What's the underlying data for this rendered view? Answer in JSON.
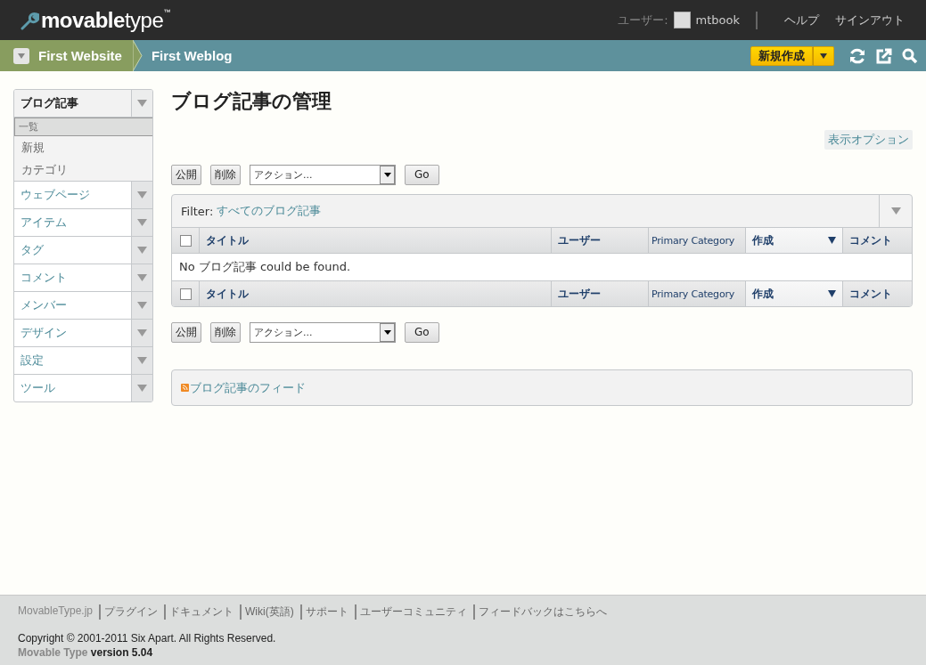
{
  "header": {
    "logo": {
      "bold": "movable",
      "light": "type",
      "mark": "™"
    },
    "user_label": "ユーザー:",
    "user": "mtbook",
    "links": [
      "ヘルプ",
      "サインアウト"
    ]
  },
  "nav": {
    "website": "First Website",
    "blog": "First Weblog",
    "new_button": "新規作成"
  },
  "sidebar": [
    {
      "label": "ブログ記事",
      "expanded": true,
      "children": [
        {
          "label": "一覧",
          "selected": true
        },
        {
          "label": "新規",
          "selected": false
        },
        {
          "label": "カテゴリ",
          "selected": false
        }
      ]
    },
    {
      "label": "ウェブページ",
      "expanded": false
    },
    {
      "label": "アイテム",
      "expanded": false
    },
    {
      "label": "タグ",
      "expanded": false
    },
    {
      "label": "コメント",
      "expanded": false
    },
    {
      "label": "メンバー",
      "expanded": false
    },
    {
      "label": "デザイン",
      "expanded": false
    },
    {
      "label": "設定",
      "expanded": false
    },
    {
      "label": "ツール",
      "expanded": false
    }
  ],
  "title": "ブログ記事の管理",
  "display_options": "表示オプション",
  "actions_top": {
    "buttons": [
      "公開",
      "削除"
    ],
    "select": "アクション...",
    "go": "Go"
  },
  "filter": {
    "label": "Filter:",
    "value": "すべてのブログ記事"
  },
  "table": {
    "columns": [
      {
        "label": "タイトル",
        "sorted": false
      },
      {
        "label": "ユーザー",
        "sorted": false
      },
      {
        "label": "Primary Category",
        "sorted": false
      },
      {
        "label": "作成",
        "sorted": true
      },
      {
        "label": "コメント",
        "sorted": false
      }
    ],
    "footer_columns": [
      {
        "label": "タイトル",
        "sorted": false
      },
      {
        "label": "ユーザー",
        "sorted": false
      },
      {
        "label": "Primary Category",
        "sorted": false
      },
      {
        "label": "作成",
        "sorted": true
      },
      {
        "label": "コメント",
        "sorted": false
      }
    ],
    "select_all_checked": false,
    "message": "No ブログ記事 could be found."
  },
  "actions_bottom": {
    "buttons": [
      "公開",
      "削除"
    ],
    "select": "アクション...",
    "go": "Go"
  },
  "feed": "ブログ記事のフィード",
  "footer": {
    "links": [
      "MovableType.jp",
      "プラグイン",
      "ドキュメント",
      "Wiki(英語)",
      "サポート",
      "ユーザーコミュニティ",
      "フィードバックはこちらへ"
    ],
    "copyright": "Copyright © 2001-2011 Six Apart. All Rights Reserved.",
    "product": "Movable Type",
    "version": "version 5.04"
  }
}
